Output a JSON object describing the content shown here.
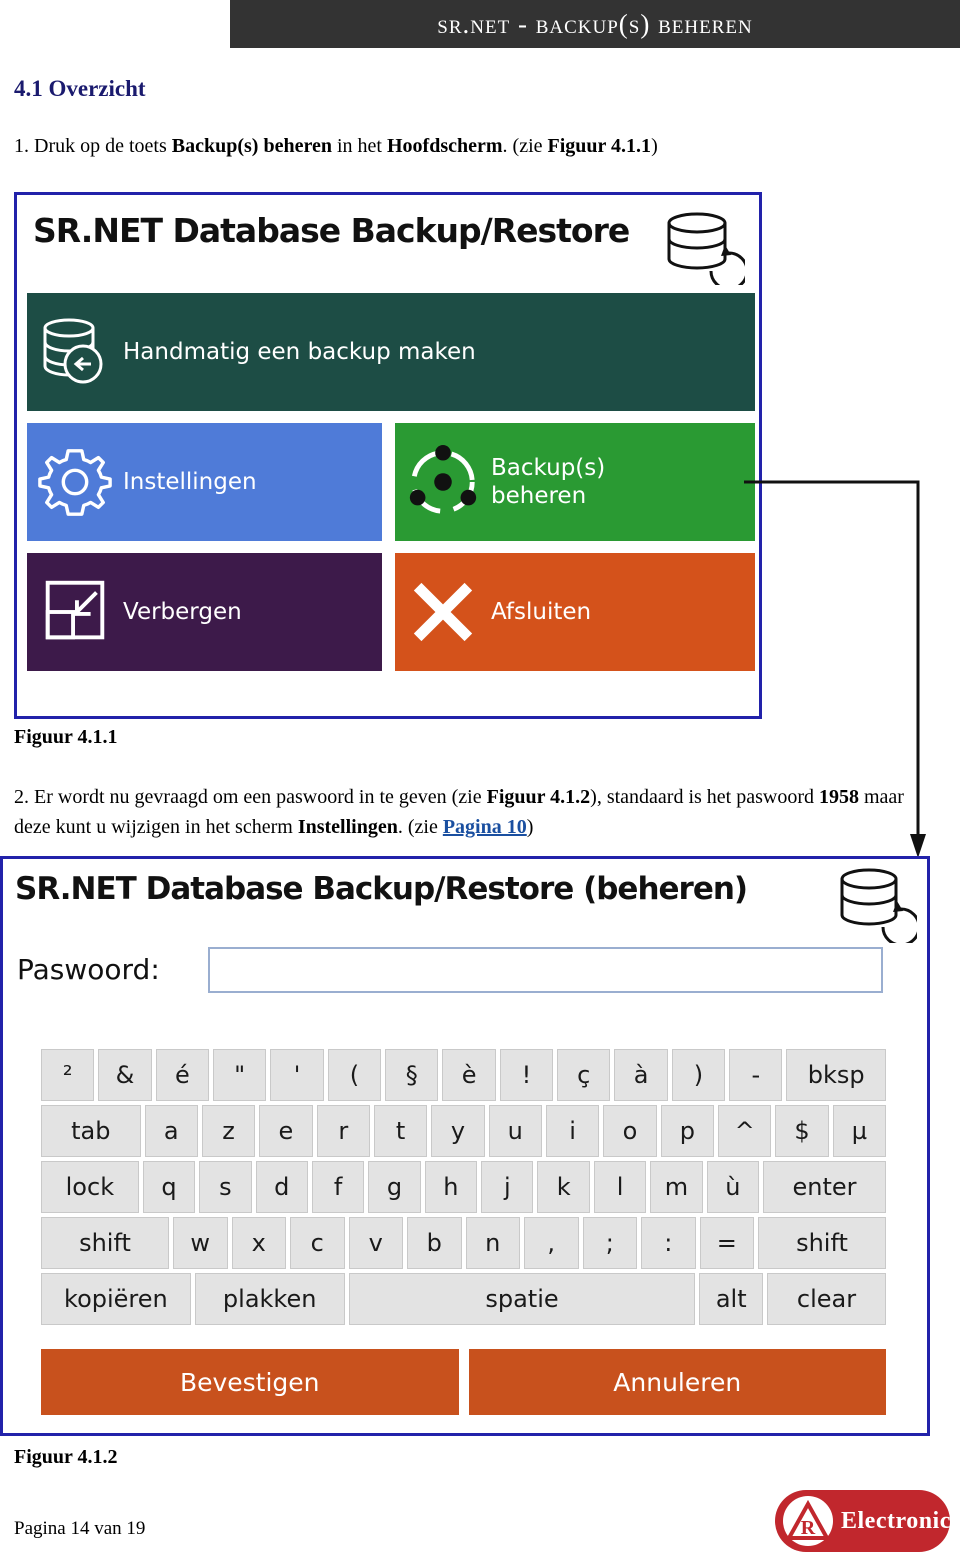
{
  "header": {
    "title": "SR.NET - Backup(s) beheren"
  },
  "section": {
    "heading": "4.1 Overzicht"
  },
  "steps": {
    "step1": {
      "number": "1.",
      "text_a": "Druk op de toets ",
      "bold_a": "Backup(s) beheren",
      "text_b": " in het ",
      "bold_b": "Hoofdscherm",
      "text_c": ". (zie ",
      "bold_c": "Figuur 4.1.1",
      "text_d": ")"
    },
    "step2": {
      "number": "2.",
      "text_a": "Er wordt nu gevraagd om een paswoord in te geven (zie ",
      "bold_a": "Figuur 4.1.2",
      "text_b": "), standaard is het paswoord ",
      "bold_b": "1958",
      "text_c": " maar deze kunt u wijzigen in het scherm ",
      "bold_c": "Instellingen",
      "text_d": ". (zie ",
      "link": "Pagina 10",
      "text_e": ")"
    }
  },
  "figure1": {
    "caption": "Figuur 4.1.1",
    "app_title": "SR.NET Database Backup/Restore",
    "tiles": [
      {
        "label": "Handmatig een backup maken",
        "icon": "database-arrow-icon",
        "color": "#1d4d45"
      },
      {
        "label": "Instellingen",
        "icon": "gear-icon",
        "color": "#4f7bd8"
      },
      {
        "label": "Backup(s)\nbeheren",
        "label_line1": "Backup(s)",
        "label_line2": "beheren",
        "icon": "ubuntu-circle-icon",
        "color": "#2a9a33"
      },
      {
        "label": "Verbergen",
        "icon": "minimize-icon",
        "color": "#3d1a4a"
      },
      {
        "label": "Afsluiten",
        "icon": "close-x-icon",
        "color": "#d4521b"
      }
    ]
  },
  "figure2": {
    "caption": "Figuur 4.1.2",
    "app_title": "SR.NET Database Backup/Restore (beheren)",
    "password_label": "Paswoord:",
    "password_value": "",
    "password_placeholder": "",
    "keyboard": {
      "row1": [
        "²",
        "&",
        "é",
        "\"",
        "'",
        "(",
        "§",
        "è",
        "!",
        "ç",
        "à",
        ")",
        "-",
        "bksp"
      ],
      "row2": [
        "tab",
        "a",
        "z",
        "e",
        "r",
        "t",
        "y",
        "u",
        "i",
        "o",
        "p",
        "^",
        "$",
        "µ"
      ],
      "row3": [
        "lock",
        "q",
        "s",
        "d",
        "f",
        "g",
        "h",
        "j",
        "k",
        "l",
        "m",
        "ù",
        "enter"
      ],
      "row4": [
        "shift",
        "w",
        "x",
        "c",
        "v",
        "b",
        "n",
        ",",
        ";",
        ":",
        "=",
        "shift"
      ],
      "row5": [
        "kopiëren",
        "plakken",
        "spatie",
        "alt",
        "clear"
      ]
    },
    "buttons": {
      "confirm": "Bevestigen",
      "cancel": "Annuleren"
    }
  },
  "footer": {
    "page": "Pagina 14 van 19",
    "logo_text": "Electronic"
  }
}
